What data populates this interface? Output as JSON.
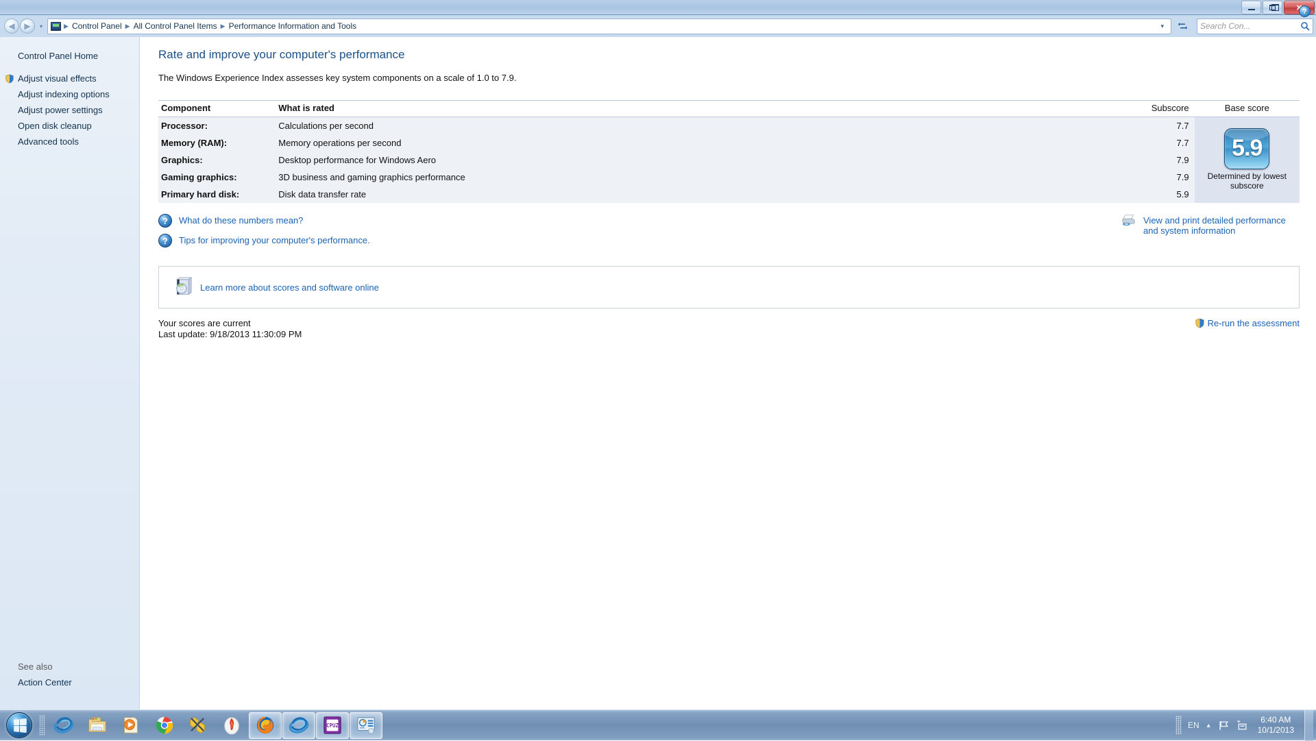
{
  "window": {
    "minimize_label": "Minimize",
    "maximize_label": "Restore",
    "close_label": "✕"
  },
  "navbar": {
    "back_icon": "◀",
    "forward_icon": "▶",
    "history_caret": "▾",
    "breadcrumbs": [
      "Control Panel",
      "All Control Panel Items",
      "Performance Information and Tools"
    ],
    "separator": "▶",
    "address_caret": "▾",
    "refresh_label": "↻",
    "search_placeholder": "Search Con...",
    "search_value": "",
    "search_icon": "search-icon"
  },
  "sidebar": {
    "home_label": "Control Panel Home",
    "items": [
      {
        "label": "Adjust visual effects",
        "shield": true
      },
      {
        "label": "Adjust indexing options",
        "shield": false
      },
      {
        "label": "Adjust power settings",
        "shield": false
      },
      {
        "label": "Open disk cleanup",
        "shield": false
      },
      {
        "label": "Advanced tools",
        "shield": false
      }
    ],
    "see_also_label": "See also",
    "see_also_items": [
      "Action Center"
    ]
  },
  "main": {
    "help_icon": "?",
    "title": "Rate and improve your computer's performance",
    "description": "The Windows Experience Index assesses key system components on a scale of 1.0 to 7.9.",
    "table": {
      "headers": {
        "component": "Component",
        "what_is_rated": "What is rated",
        "subscore": "Subscore",
        "base_score": "Base score"
      },
      "rows": [
        {
          "component": "Processor:",
          "what_is_rated": "Calculations per second",
          "subscore": "7.7"
        },
        {
          "component": "Memory (RAM):",
          "what_is_rated": "Memory operations per second",
          "subscore": "7.7"
        },
        {
          "component": "Graphics:",
          "what_is_rated": "Desktop performance for Windows Aero",
          "subscore": "7.9"
        },
        {
          "component": "Gaming graphics:",
          "what_is_rated": "3D business and gaming graphics performance",
          "subscore": "7.9"
        },
        {
          "component": "Primary hard disk:",
          "what_is_rated": "Disk data transfer rate",
          "subscore": "5.9"
        }
      ],
      "base_score_value": "5.9",
      "base_score_caption": "Determined by lowest subscore"
    },
    "links": {
      "numbers_mean": "What do these numbers mean?",
      "tips": "Tips for improving your computer's performance.",
      "print_details": "View and print detailed performance and system information",
      "learn_more": "Learn more about scores and software online"
    },
    "status": {
      "current": "Your scores are current",
      "last_update": "Last update: 9/18/2013 11:30:09 PM",
      "rerun_label": "Re-run the assessment"
    }
  },
  "taskbar": {
    "start_label": "Start",
    "items": [
      {
        "name": "internet-explorer",
        "active": false
      },
      {
        "name": "windows-explorer",
        "active": false
      },
      {
        "name": "windows-media-player",
        "active": false
      },
      {
        "name": "google-chrome",
        "active": false
      },
      {
        "name": "tools-utility",
        "active": false
      },
      {
        "name": "flame-app",
        "active": false
      },
      {
        "name": "mozilla-firefox",
        "active": true
      },
      {
        "name": "internet-explorer-window",
        "active": true
      },
      {
        "name": "cpu-z",
        "active": true
      },
      {
        "name": "system-monitor",
        "active": true
      }
    ],
    "tray": {
      "language": "EN",
      "chevron": "▲",
      "flag_icon": "action-center-flag",
      "network_icon": "network-icon",
      "time": "6:40 AM",
      "date": "10/1/2013"
    }
  }
}
